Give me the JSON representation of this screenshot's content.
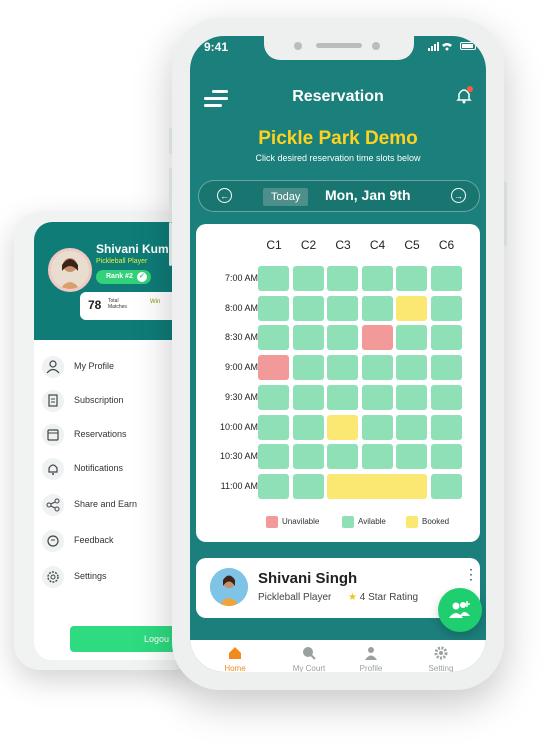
{
  "colors": {
    "teal": "#1b7f7b",
    "available": "#8fe0b6",
    "unavailable": "#f29a9a",
    "booked": "#fbe872",
    "accent_orange": "#f28b1c",
    "title_yellow": "#ffd21f"
  },
  "side_menu": {
    "user_name": "Shivani Kum",
    "user_role": "Pickleball Player",
    "rank": "Rank #2",
    "total_matches_value": "78",
    "total_matches_label": "Total Matches",
    "win_label": "Win",
    "items": [
      {
        "label": "My Profile",
        "icon": "user-icon"
      },
      {
        "label": "Subscription",
        "icon": "document-icon"
      },
      {
        "label": "Reservations",
        "icon": "calendar-icon"
      },
      {
        "label": "Notifications",
        "icon": "bell-icon"
      },
      {
        "label": "Share and Earn",
        "icon": "share-icon"
      },
      {
        "label": "Feedback",
        "icon": "feedback-icon"
      },
      {
        "label": "Settings",
        "icon": "gear-icon"
      }
    ],
    "logout_label": "Logou"
  },
  "status_bar": {
    "time": "9:41"
  },
  "app_bar": {
    "title": "Reservation"
  },
  "club": {
    "name": "Pickle Park Demo",
    "instruction": "Click desired reservation time slots below"
  },
  "date_bar": {
    "today_label": "Today",
    "date": "Mon, Jan 9th"
  },
  "grid": {
    "courts": [
      "C1",
      "C2",
      "C3",
      "C4",
      "C5",
      "C6"
    ],
    "times": [
      "7:00 AM",
      "8:00 AM",
      "8:30 AM",
      "9:00 AM",
      "9:30 AM",
      "10:00 AM",
      "10:30 AM",
      "11:00 AM"
    ],
    "status": [
      [
        "available",
        "available",
        "available",
        "available",
        "available",
        "available"
      ],
      [
        "available",
        "available",
        "available",
        "available",
        "booked",
        "available"
      ],
      [
        "available",
        "available",
        "available",
        "unavailable",
        "available",
        "available"
      ],
      [
        "unavailable",
        "available",
        "available",
        "available",
        "available",
        "available"
      ],
      [
        "available",
        "available",
        "available",
        "available",
        "available",
        "available"
      ],
      [
        "available",
        "available",
        "booked",
        "available",
        "available",
        "available"
      ],
      [
        "available",
        "available",
        "available",
        "available",
        "available",
        "available"
      ],
      [
        "available",
        "available",
        "booked",
        "booked",
        "booked",
        "available"
      ]
    ],
    "legend": {
      "unavailable": "Unavilable",
      "available": "Avilable",
      "booked": "Booked"
    }
  },
  "user_card": {
    "name": "Shivani Singh",
    "role": "Pickleball Player",
    "rating": "4 Star Rating"
  },
  "bottom_nav": [
    {
      "label": "Home",
      "icon": "home-icon",
      "active": true
    },
    {
      "label": "My Court",
      "icon": "paddle-icon",
      "active": false
    },
    {
      "label": "Profile",
      "icon": "person-icon",
      "active": false
    },
    {
      "label": "Setting",
      "icon": "gear-icon",
      "active": false
    }
  ]
}
